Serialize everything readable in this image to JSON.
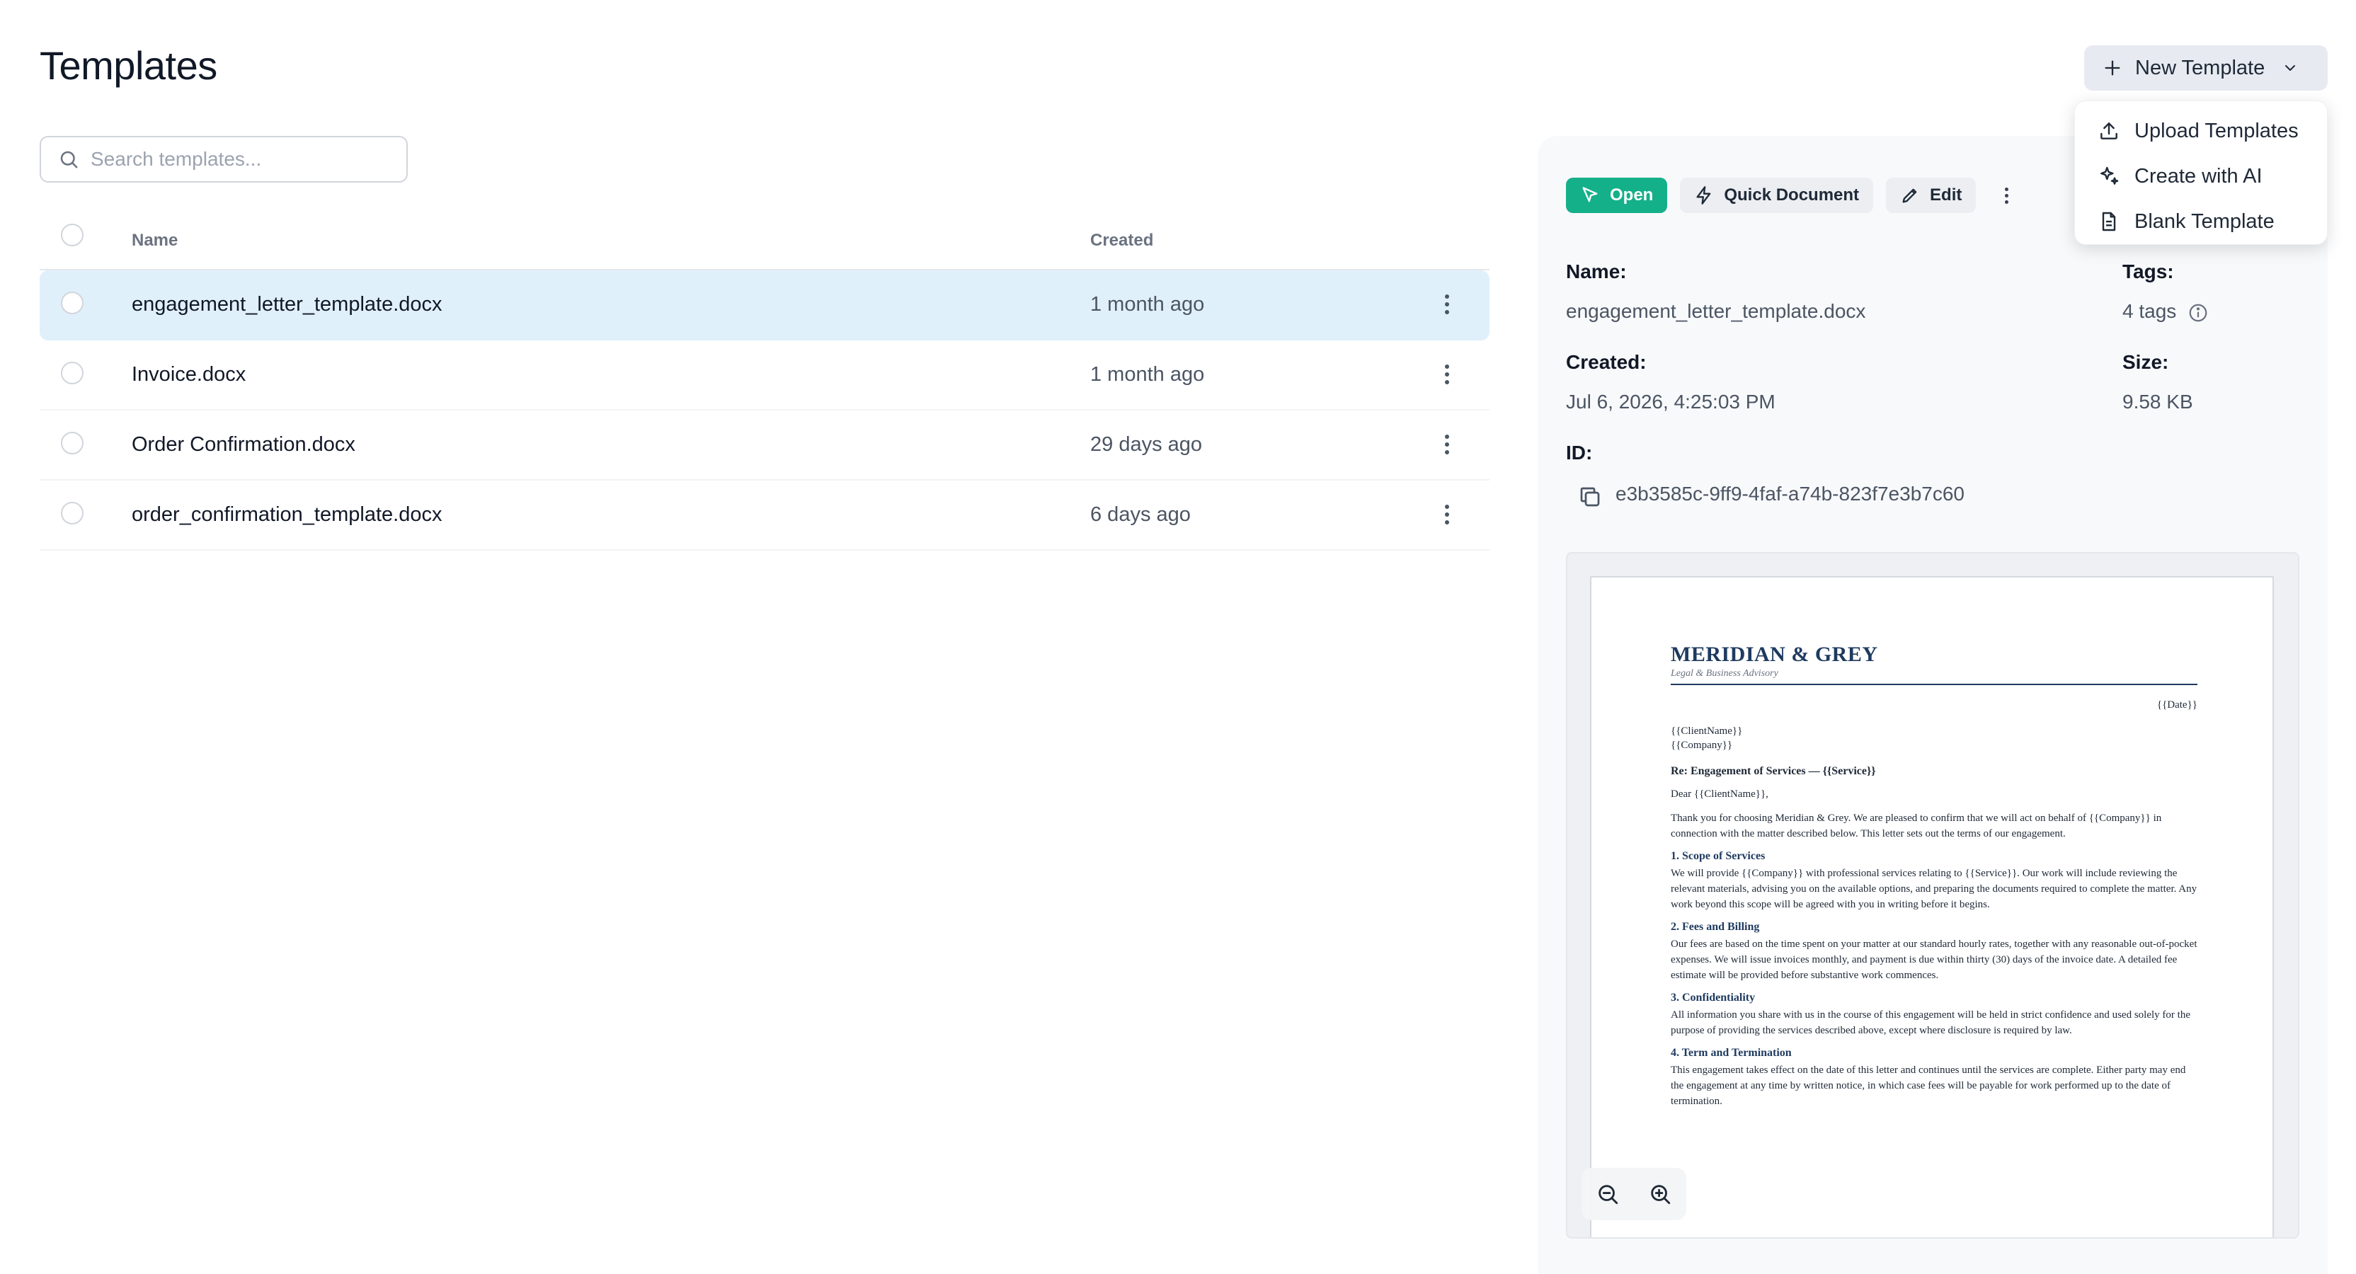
{
  "page": {
    "title": "Templates"
  },
  "search": {
    "placeholder": "Search templates..."
  },
  "table": {
    "headers": {
      "name": "Name",
      "created": "Created"
    },
    "rows": [
      {
        "name": "engagement_letter_template.docx",
        "created": "1 month ago",
        "selected": true
      },
      {
        "name": "Invoice.docx",
        "created": "1 month ago",
        "selected": false
      },
      {
        "name": "Order Confirmation.docx",
        "created": "29 days ago",
        "selected": false
      },
      {
        "name": "order_confirmation_template.docx",
        "created": "6 days ago",
        "selected": false
      }
    ]
  },
  "toolbar": {
    "open_label": "Open",
    "quick_document_label": "Quick Document",
    "edit_label": "Edit"
  },
  "new_template": {
    "label": "New Template",
    "menu": [
      {
        "label": "Upload Templates",
        "icon": "upload-icon"
      },
      {
        "label": "Create with AI",
        "icon": "sparkles-icon"
      },
      {
        "label": "Blank Template",
        "icon": "file-icon"
      }
    ]
  },
  "details": {
    "name_label": "Name:",
    "name_value": "engagement_letter_template.docx",
    "tags_label": "Tags:",
    "tags_value": "4 tags",
    "created_label": "Created:",
    "created_value": "Jul 6, 2026, 4:25:03 PM",
    "size_label": "Size:",
    "size_value": "9.58 KB",
    "id_label": "ID:",
    "id_value": "e3b3585c-9ff9-4faf-a74b-823f7e3b7c60"
  },
  "preview": {
    "firm_name": "MERIDIAN & GREY",
    "firm_subtitle": "Legal & Business Advisory",
    "date_placeholder": "{{Date}}",
    "client_name": "{{ClientName}}",
    "company": "{{Company}}",
    "re_line": "Re: Engagement of Services — {{Service}}",
    "salutation": "Dear {{ClientName}},",
    "intro": "Thank you for choosing Meridian & Grey. We are pleased to confirm that we will act on behalf of {{Company}} in connection with the matter described below. This letter sets out the terms of our engagement.",
    "section1_title": "1. Scope of Services",
    "section1_body": "We will provide {{Company}} with professional services relating to {{Service}}. Our work will include reviewing the relevant materials, advising you on the available options, and preparing the documents required to complete the matter. Any work beyond this scope will be agreed with you in writing before it begins.",
    "section2_title": "2. Fees and Billing",
    "section2_body": "Our fees are based on the time spent on your matter at our standard hourly rates, together with any reasonable out-of-pocket expenses. We will issue invoices monthly, and payment is due within thirty (30) days of the invoice date. A detailed fee estimate will be provided before substantive work commences.",
    "section3_title": "3. Confidentiality",
    "section3_body": "All information you share with us in the course of this engagement will be held in strict confidence and used solely for the purpose of providing the services described above, except where disclosure is required by law.",
    "section4_title": "4. Term and Termination",
    "section4_body": "This engagement takes effect on the date of this letter and continues until the services are complete. Either party may end the engagement at any time by written notice, in which case fees will be payable for work performed up to the date of termination."
  },
  "colors": {
    "accent_green": "#14b08a",
    "selected_row": "#e0f0fb",
    "firm_navy": "#1e3a5f"
  }
}
